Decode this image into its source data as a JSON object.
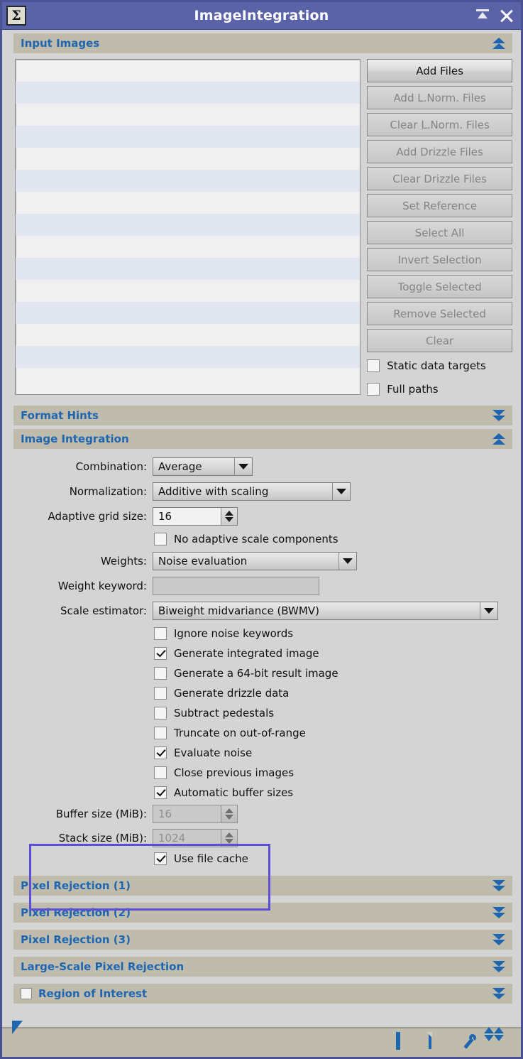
{
  "window": {
    "title": "ImageIntegration",
    "process_icon": "Σ",
    "icon_name": "sigma-process-icon",
    "titlebar_color": "#5a62a8",
    "accent_color": "#1f66b0",
    "section_header_color": "#bfbcae",
    "highlight_color": "#5b4fd8",
    "buttons": [
      {
        "name": "roll-up-button",
        "icon": "roll-up-icon"
      },
      {
        "name": "close-button",
        "icon": "close-icon"
      }
    ]
  },
  "sections": {
    "input_images": {
      "title": "Input Images",
      "state": "expanded",
      "chevron": "chevron-up-icon"
    },
    "format_hints": {
      "title": "Format Hints",
      "state": "collapsed",
      "chevron": "chevron-down-icon"
    },
    "image_integration": {
      "title": "Image Integration",
      "state": "expanded",
      "chevron": "chevron-up-icon"
    },
    "pixel_rejection_1": {
      "title": "Pixel Rejection (1)",
      "state": "collapsed",
      "chevron": "chevron-down-icon"
    },
    "pixel_rejection_2": {
      "title": "Pixel Rejection (2)",
      "state": "collapsed",
      "chevron": "chevron-down-icon"
    },
    "pixel_rejection_3": {
      "title": "Pixel Rejection (3)",
      "state": "collapsed",
      "chevron": "chevron-down-icon"
    },
    "large_scale_pixel_rejection": {
      "title": "Large-Scale Pixel Rejection",
      "state": "collapsed",
      "chevron": "chevron-down-icon"
    },
    "region_of_interest": {
      "title": "Region of Interest",
      "state": "collapsed",
      "checked": false,
      "chevron": "chevron-down-icon"
    }
  },
  "input_images": {
    "file_list": {
      "items": [],
      "row_count": 15
    },
    "buttons": [
      {
        "label": "Add Files",
        "enabled": true
      },
      {
        "label": "Add L.Norm. Files",
        "enabled": false
      },
      {
        "label": "Clear L.Norm. Files",
        "enabled": false
      },
      {
        "label": "Add Drizzle Files",
        "enabled": false
      },
      {
        "label": "Clear Drizzle Files",
        "enabled": false
      },
      {
        "label": "Set Reference",
        "enabled": false
      },
      {
        "label": "Select All",
        "enabled": false
      },
      {
        "label": "Invert Selection",
        "enabled": false
      },
      {
        "label": "Toggle Selected",
        "enabled": false
      },
      {
        "label": "Remove Selected",
        "enabled": false
      },
      {
        "label": "Clear",
        "enabled": false
      }
    ],
    "checkboxes": [
      {
        "label": "Static data targets",
        "checked": false
      },
      {
        "label": "Full paths",
        "checked": false
      }
    ]
  },
  "image_integration": {
    "combination": {
      "label": "Combination:",
      "value": "Average"
    },
    "normalization": {
      "label": "Normalization:",
      "value": "Additive with scaling"
    },
    "adaptive_grid_size": {
      "label": "Adaptive grid size:",
      "value": "16"
    },
    "no_adaptive_scale": {
      "label": "No adaptive scale components",
      "checked": false
    },
    "weights": {
      "label": "Weights:",
      "value": "Noise evaluation"
    },
    "weight_keyword": {
      "label": "Weight keyword:",
      "value": "",
      "placeholder": ""
    },
    "scale_estimator": {
      "label": "Scale estimator:",
      "value": "Biweight midvariance (BWMV)"
    },
    "options": [
      {
        "label": "Ignore noise keywords",
        "checked": false
      },
      {
        "label": "Generate integrated image",
        "checked": true
      },
      {
        "label": "Generate a 64-bit result image",
        "checked": false
      },
      {
        "label": "Generate drizzle data",
        "checked": false
      },
      {
        "label": "Subtract pedestals",
        "checked": false
      },
      {
        "label": "Truncate on out-of-range",
        "checked": false
      },
      {
        "label": "Evaluate noise",
        "checked": true
      },
      {
        "label": "Close previous images",
        "checked": false
      },
      {
        "label": "Automatic buffer sizes",
        "checked": true
      }
    ],
    "buffer_size": {
      "label": "Buffer size (MiB):",
      "value": "16",
      "enabled": false
    },
    "stack_size": {
      "label": "Stack size (MiB):",
      "value": "1024",
      "enabled": false
    },
    "use_file_cache": {
      "label": "Use file cache",
      "checked": true
    }
  },
  "toolbar": {
    "left": [
      {
        "name": "apply-button",
        "icon": "triangle-apply-icon"
      },
      {
        "name": "apply-global-button",
        "icon": "circle-apply-global-icon"
      }
    ],
    "right": [
      {
        "name": "browse-documentation-button",
        "icon": "square-icon"
      },
      {
        "name": "reset-button",
        "icon": "document-reset-icon"
      },
      {
        "name": "preferences-button",
        "icon": "wrench-icon"
      },
      {
        "name": "collapse-button",
        "icon": "collapse-arrows-icon"
      }
    ]
  }
}
